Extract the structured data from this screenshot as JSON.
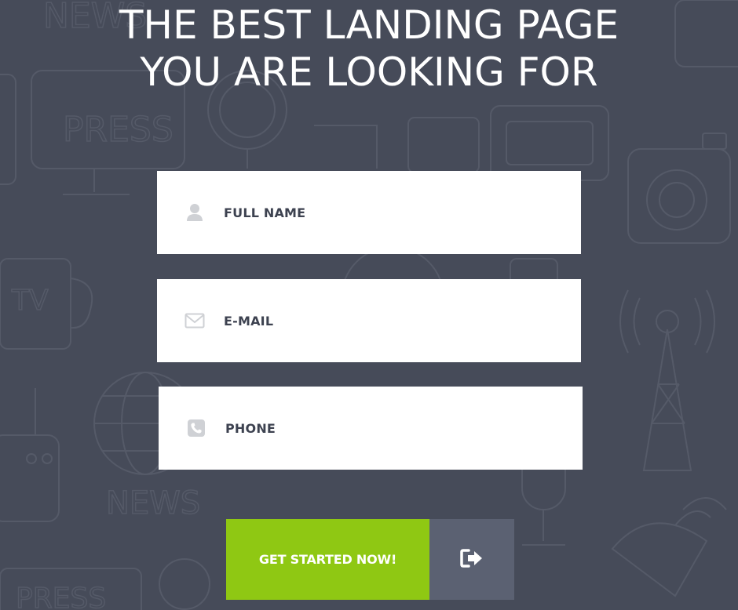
{
  "headline": {
    "line1": "THE BEST LANDING PAGE",
    "line2": "YOU ARE LOOKING FOR"
  },
  "background": {
    "texts": [
      "NEWS",
      "PRESS",
      "TV",
      "NEWS",
      "PRESS"
    ]
  },
  "form": {
    "full_name": {
      "placeholder": "FULL NAME",
      "icon": "user-icon"
    },
    "email": {
      "placeholder": "E-MAIL",
      "icon": "envelope-icon"
    },
    "phone": {
      "placeholder": "PHONE",
      "icon": "phone-icon"
    }
  },
  "cta": {
    "label": "GET STARTED NOW!",
    "icon": "sign-out-arrow-icon"
  },
  "colors": {
    "background": "#464b59",
    "pattern": "#565b69",
    "accent_green": "#8fc813",
    "arrow_bg": "#5b6172",
    "field_text": "#3d4250",
    "icon_grey": "#cfd1d5"
  }
}
